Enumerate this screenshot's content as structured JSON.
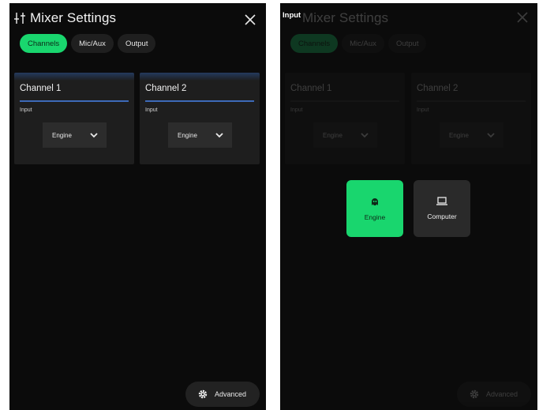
{
  "left_screen": {
    "title": "Mixer Settings",
    "tabs": [
      {
        "label": "Channels",
        "active": true
      },
      {
        "label": "Mic/Aux",
        "active": false
      },
      {
        "label": "Output",
        "active": false
      }
    ],
    "channels": [
      {
        "name": "Channel 1",
        "input_label": "Input",
        "input_value": "Engine"
      },
      {
        "name": "Channel 2",
        "input_label": "Input",
        "input_value": "Engine"
      }
    ],
    "advanced_label": "Advanced"
  },
  "right_screen": {
    "overlay_title": "Input",
    "background_title": "Mixer Settings",
    "background_tabs": [
      "Channels",
      "Mic/Aux",
      "Output"
    ],
    "background_channels": [
      {
        "name": "Channel 1",
        "input_label": "Input",
        "input_value": "Engine"
      },
      {
        "name": "Channel 2",
        "input_label": "Input",
        "input_value": "Engine"
      }
    ],
    "background_advanced_label": "Advanced",
    "options": [
      {
        "label": "Engine",
        "icon": "engine-icon",
        "selected": true
      },
      {
        "label": "Computer",
        "icon": "laptop-icon",
        "selected": false
      }
    ]
  },
  "colors": {
    "accent_green": "#19d66e",
    "background": "#0b0b0b",
    "card": "#1e1e1e",
    "underline_blue": "#3d6ab8"
  }
}
